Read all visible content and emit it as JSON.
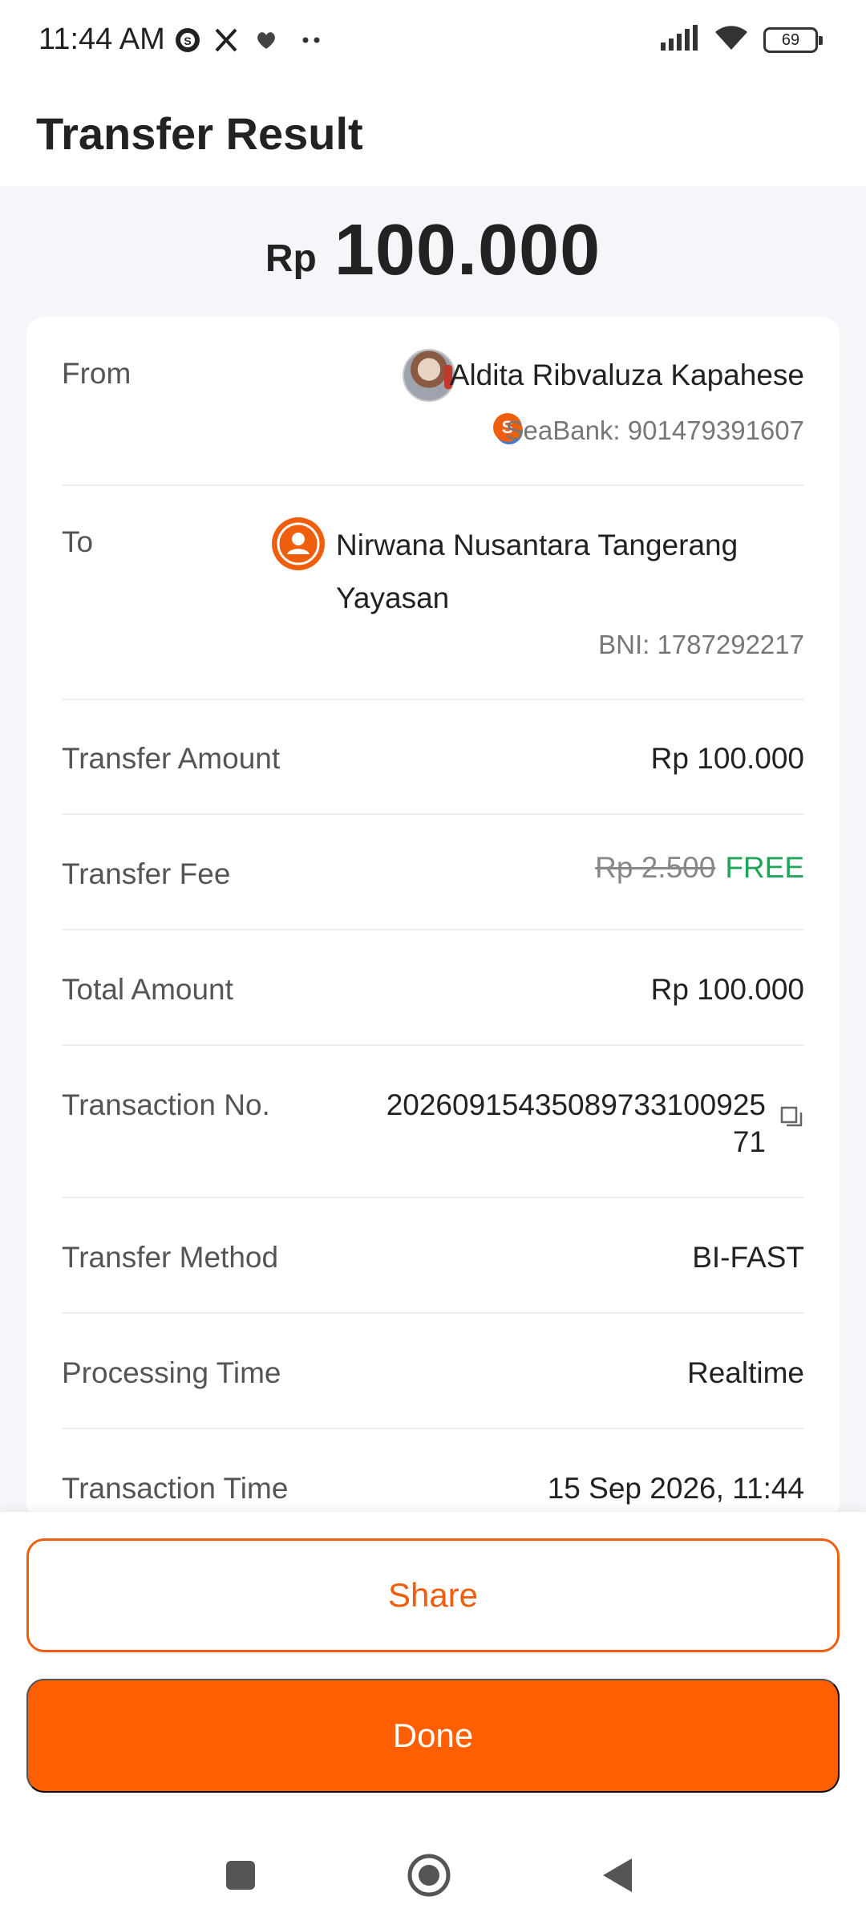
{
  "status_bar": {
    "time": "11:44 AM",
    "battery": "69",
    "icons": [
      "seabank-notification-icon",
      "x-icon",
      "heart-icon",
      "more-dots-icon",
      "signal-icon",
      "wifi-icon",
      "battery-icon"
    ]
  },
  "header": {
    "title": "Transfer Result"
  },
  "amount": {
    "currency": "Rp",
    "value": "100.000"
  },
  "from": {
    "label": "From",
    "name": "Aldita Ribvaluza Kapahese",
    "account": "SeaBank: 901479391607"
  },
  "to": {
    "label": "To",
    "name_line1": "Nirwana Nusantara Tangerang",
    "name_line2": "Yayasan",
    "account": "BNI: 1787292217"
  },
  "details": {
    "transfer_amount": {
      "label": "Transfer Amount",
      "value": "Rp 100.000"
    },
    "transfer_fee": {
      "label": "Transfer Fee",
      "original": "Rp 2.500",
      "value": "FREE"
    },
    "total_amount": {
      "label": "Total Amount",
      "value": "Rp 100.000"
    },
    "transaction_no": {
      "label": "Transaction No.",
      "line1": "2026091543508973310092​5",
      "line2": "71"
    },
    "transfer_method": {
      "label": "Transfer Method",
      "value": "BI-FAST"
    },
    "processing_time": {
      "label": "Processing Time",
      "value": "Realtime"
    },
    "transaction_time": {
      "label": "Transaction Time",
      "value": "15 Sep 2026, 11:44"
    }
  },
  "actions": {
    "share_label": "Share",
    "done_label": "Done"
  },
  "colors": {
    "accent": "#ee5e0d",
    "primary_button": "#ff5f00",
    "free_text": "#1fa45a",
    "background": "#f4f6f9"
  }
}
